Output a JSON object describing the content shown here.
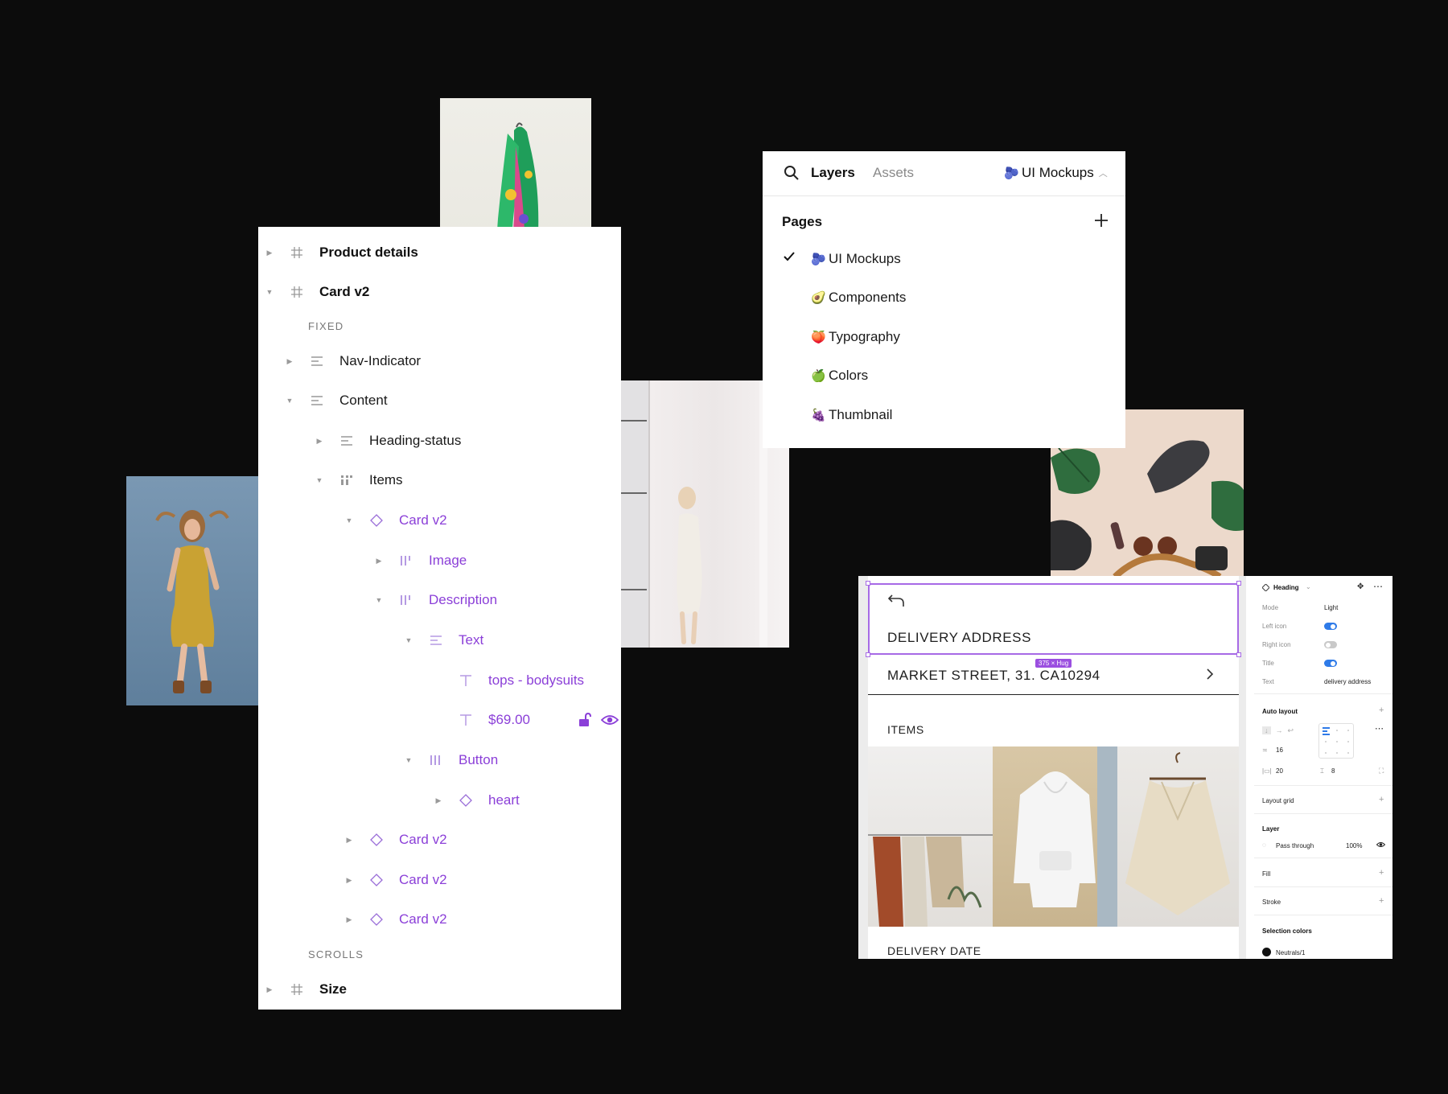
{
  "layers": {
    "top_frame": "Product details",
    "frame": "Card v2",
    "section_fixed": "FIXED",
    "nav_indicator": "Nav-Indicator",
    "content": "Content",
    "heading_status": "Heading-status",
    "items": "Items",
    "card_1": "Card v2",
    "image": "Image",
    "description": "Description",
    "text_group": "Text",
    "text_category": "tops - bodysuits",
    "text_price": "$69.00",
    "button": "Button",
    "heart": "heart",
    "card_2": "Card v2",
    "card_3": "Card v2",
    "card_4": "Card v2",
    "section_scrolls": "SCROLLS",
    "size_frame": "Size"
  },
  "pages_panel": {
    "tab_layers": "Layers",
    "tab_assets": "Assets",
    "current_page": "UI Mockups",
    "pages_title": "Pages",
    "pages": [
      {
        "emoji": "🫐",
        "label": "UI Mockups",
        "selected": true
      },
      {
        "emoji": "🥑",
        "label": "Components",
        "selected": false
      },
      {
        "emoji": "🍑",
        "label": "Typography",
        "selected": false
      },
      {
        "emoji": "🍏",
        "label": "Colors",
        "selected": false
      },
      {
        "emoji": "🍇",
        "label": "Thumbnail",
        "selected": false
      }
    ]
  },
  "mockup": {
    "heading": "DELIVERY ADDRESS",
    "size_badge": "375 × Hug",
    "address": "MARKET STREET, 31. CA10294",
    "items_label": "ITEMS",
    "next_section": "DELIVERY DATE"
  },
  "properties": {
    "component": "Heading",
    "mode_label": "Mode",
    "mode_value": "Light",
    "left_icon_label": "Left icon",
    "left_icon_on": true,
    "right_icon_label": "Right icon",
    "right_icon_on": false,
    "title_label": "Title",
    "title_on": true,
    "text_label": "Text",
    "text_value": "delivery address",
    "auto_layout": "Auto layout",
    "spacing": "16",
    "padding_h": "20",
    "padding_v": "8",
    "layout_grid": "Layout grid",
    "layer": "Layer",
    "blend": "Pass through",
    "opacity": "100%",
    "fill": "Fill",
    "stroke": "Stroke",
    "selection_colors": "Selection colors",
    "color_name": "Neutrals/1"
  },
  "colors": {
    "background": "#0c0c0c",
    "accent_purple": "#8b3fd8",
    "toggle_blue": "#2f7be8",
    "selection_outline": "#a76ae6"
  }
}
